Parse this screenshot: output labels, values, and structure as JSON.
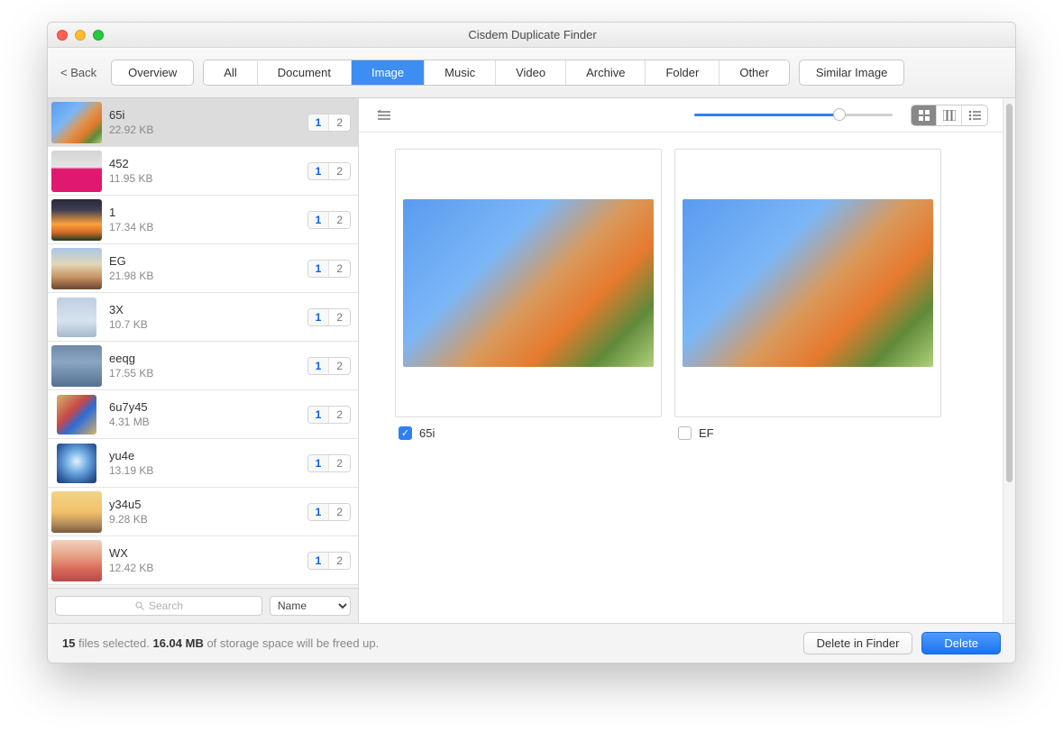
{
  "window": {
    "title": "Cisdem Duplicate Finder"
  },
  "toolbar": {
    "back": "< Back",
    "overview": "Overview",
    "tabs": [
      "All",
      "Document",
      "Image",
      "Music",
      "Video",
      "Archive",
      "Folder",
      "Other"
    ],
    "active_tab_index": 2,
    "similar": "Similar Image"
  },
  "sidebar": {
    "items": [
      {
        "name": "65i",
        "size": "22.92 KB",
        "sel": "1",
        "tot": "2",
        "thumb": "ph-butterfly",
        "sq": false,
        "selected": true
      },
      {
        "name": "452",
        "size": "11.95 KB",
        "sel": "1",
        "tot": "2",
        "thumb": "ph-pink",
        "sq": false,
        "selected": false
      },
      {
        "name": "1",
        "size": "17.34 KB",
        "sel": "1",
        "tot": "2",
        "thumb": "ph-sunset",
        "sq": false,
        "selected": false
      },
      {
        "name": "EG",
        "size": "21.98 KB",
        "sel": "1",
        "tot": "2",
        "thumb": "ph-lake",
        "sq": false,
        "selected": false
      },
      {
        "name": "3X",
        "size": "10.7 KB",
        "sel": "1",
        "tot": "2",
        "thumb": "ph-sky",
        "sq": true,
        "selected": false
      },
      {
        "name": "eeqg",
        "size": "17.55 KB",
        "sel": "1",
        "tot": "2",
        "thumb": "ph-sea",
        "sq": false,
        "selected": false
      },
      {
        "name": "6u7y45",
        "size": "4.31 MB",
        "sel": "1",
        "tot": "2",
        "thumb": "ph-toy",
        "sq": true,
        "selected": false
      },
      {
        "name": "yu4e",
        "size": "13.19 KB",
        "sel": "1",
        "tot": "2",
        "thumb": "ph-orb",
        "sq": true,
        "selected": false
      },
      {
        "name": "y34u5",
        "size": "9.28 KB",
        "sel": "1",
        "tot": "2",
        "thumb": "ph-hiker",
        "sq": false,
        "selected": false
      },
      {
        "name": "WX",
        "size": "12.42 KB",
        "sel": "1",
        "tot": "2",
        "thumb": "ph-couple",
        "sq": false,
        "selected": false
      }
    ],
    "search_placeholder": "Search",
    "sort": "Name"
  },
  "preview": {
    "zoom_percent": 73,
    "view_mode_index": 0,
    "items": [
      {
        "label": "65i",
        "checked": true,
        "thumb": "ph-butterfly"
      },
      {
        "label": "EF",
        "checked": false,
        "thumb": "ph-butterfly"
      }
    ]
  },
  "status": {
    "selected_count": "15",
    "selected_label": " files selected. ",
    "freed_size": "16.04 MB",
    "freed_label": " of storage space will be freed up.",
    "delete_in_finder": "Delete in Finder",
    "delete": "Delete"
  }
}
